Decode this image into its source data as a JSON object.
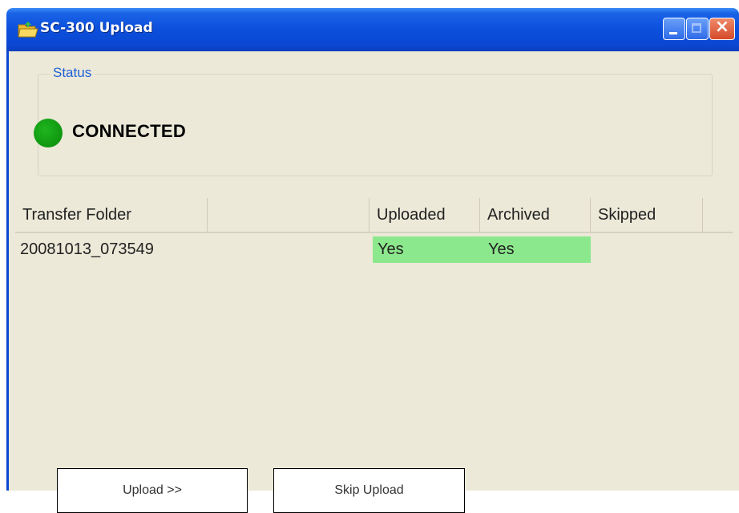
{
  "window": {
    "title": "SC-300 Upload"
  },
  "status": {
    "legend": "Status",
    "state_text": "CONNECTED",
    "indicator_color": "#0a8a0a"
  },
  "transfer_list": {
    "columns": [
      "Transfer Folder",
      "",
      "Uploaded",
      "Archived",
      "Skipped"
    ],
    "rows": [
      {
        "folder": "20081013_073549",
        "uploaded": "Yes",
        "archived": "Yes",
        "skipped": "",
        "highlight_color": "#8ce88c"
      }
    ]
  },
  "buttons": {
    "upload": "Upload >>",
    "skip": "Skip Upload"
  },
  "colors": {
    "titlebar": "#0a47d2",
    "window_bg": "#ece9d8",
    "legend_text": "#1c5fd8"
  }
}
